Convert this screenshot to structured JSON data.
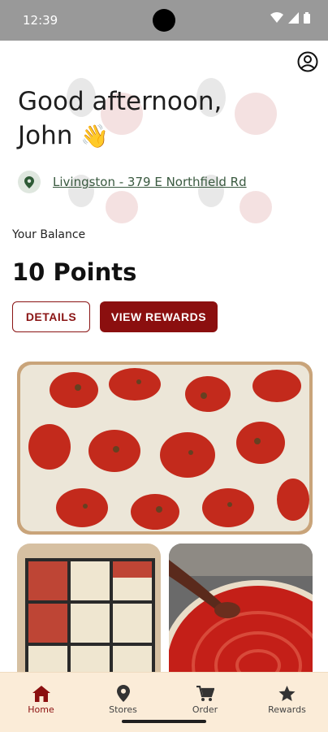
{
  "status": {
    "time": "12:39"
  },
  "greeting": {
    "line1": "Good afternoon,",
    "line2": "John",
    "emoji": "👋"
  },
  "location": {
    "store_name": "Livingston - 379 E Northfield Rd"
  },
  "balance": {
    "label": "Your Balance",
    "points": "10 Points"
  },
  "actions": {
    "details_label": "DETAILS",
    "view_rewards_label": "VIEW REWARDS"
  },
  "navbar": {
    "items": [
      {
        "label": "Home",
        "icon": "home-icon",
        "active": true
      },
      {
        "label": "Stores",
        "icon": "location-pin-icon",
        "active": false
      },
      {
        "label": "Order",
        "icon": "cart-icon",
        "active": false
      },
      {
        "label": "Rewards",
        "icon": "star-icon",
        "active": false
      }
    ]
  },
  "colors": {
    "brand_red": "#8b0f0f",
    "nav_background": "#fbecd8",
    "link_green": "#3a5a40"
  }
}
